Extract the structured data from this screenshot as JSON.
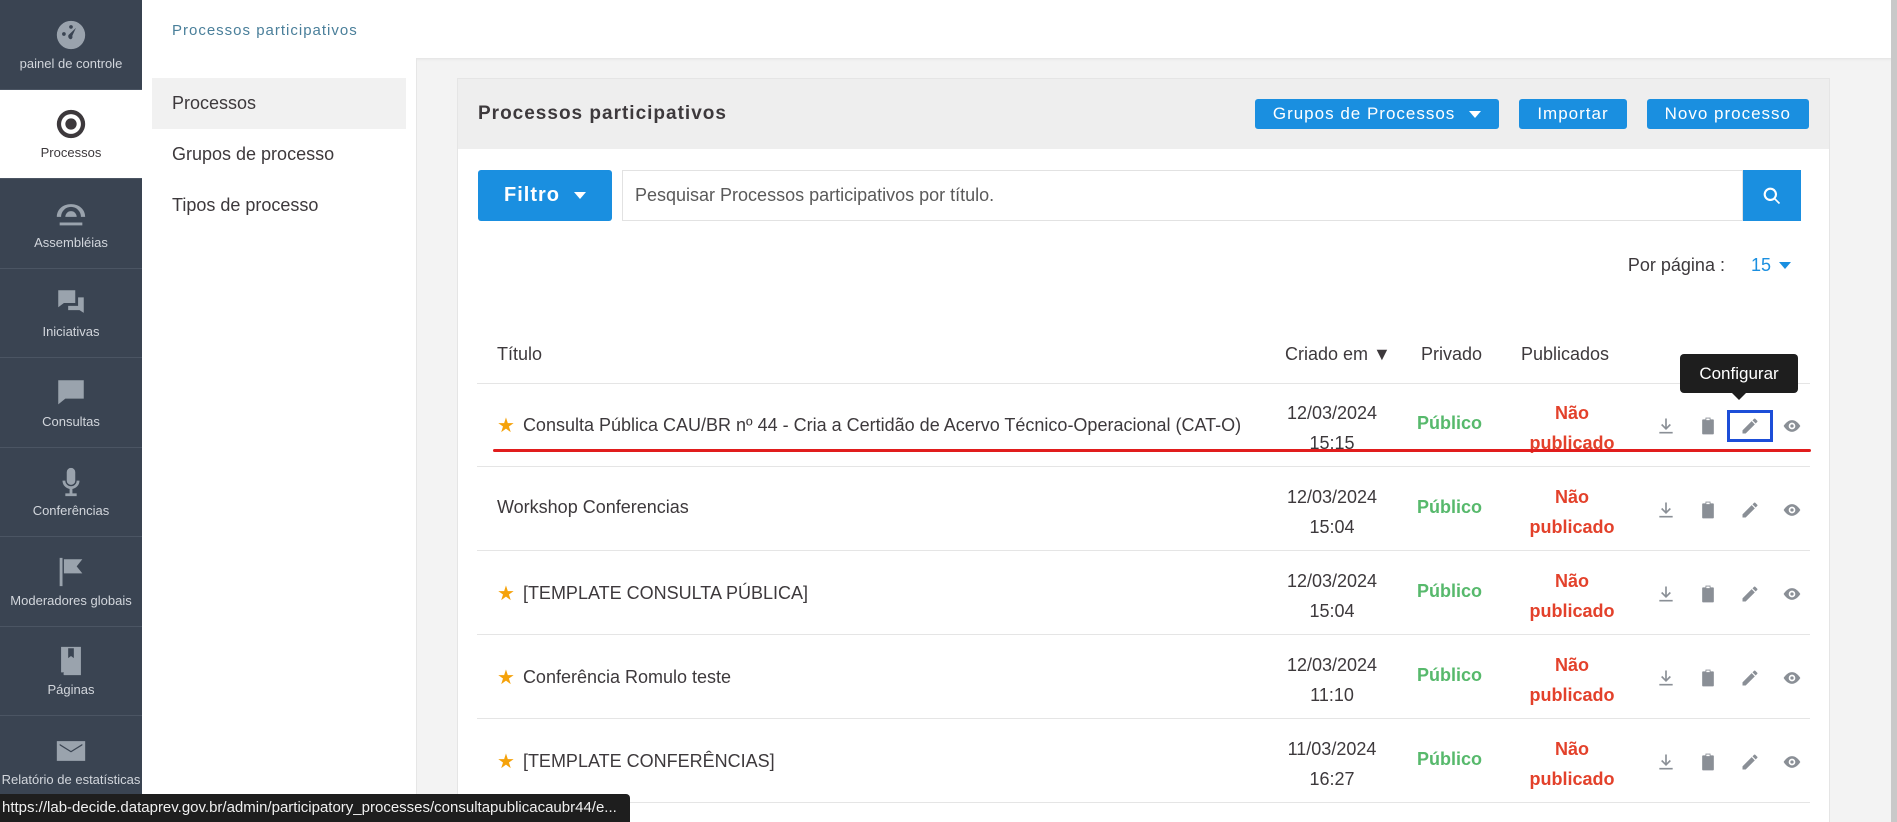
{
  "sidebar": {
    "items": [
      {
        "label": "painel de controle",
        "icon": "dashboard-icon"
      },
      {
        "label": "Processos",
        "icon": "target-icon"
      },
      {
        "label": "Assembléias",
        "icon": "assembly-icon"
      },
      {
        "label": "Iniciativas",
        "icon": "chat-bubbles-icon"
      },
      {
        "label": "Consultas",
        "icon": "chat-bubble-icon"
      },
      {
        "label": "Conferências",
        "icon": "microphone-icon"
      },
      {
        "label": "Moderadores globais",
        "icon": "flag-icon"
      },
      {
        "label": "Páginas",
        "icon": "book-icon"
      },
      {
        "label": "Relatório de estatísticas",
        "icon": "mail-icon"
      }
    ]
  },
  "topbar": {
    "breadcrumb": "Processos participativos"
  },
  "submenu": {
    "items": [
      {
        "label": "Processos"
      },
      {
        "label": "Grupos de processo"
      },
      {
        "label": "Tipos de processo"
      }
    ]
  },
  "card": {
    "title": "Processos participativos",
    "groups_button": "Grupos de Processos",
    "import_button": "Importar",
    "new_button": "Novo processo",
    "filter_button": "Filtro",
    "search_placeholder": "Pesquisar Processos participativos por título.",
    "per_page_label": "Por página :",
    "per_page_value": "15"
  },
  "table": {
    "headers": {
      "title": "Título",
      "created": "Criado em ▼",
      "private": "Privado",
      "published": "Publicados"
    },
    "rows": [
      {
        "title": "Consulta Pública CAU/BR nº 44 - Cria a Certidão de Acervo Técnico-Operacional (CAT-O)",
        "starred": true,
        "date": "12/03/2024",
        "time": "15:15",
        "private": "Público",
        "pub1": "Não",
        "pub2": "publicado"
      },
      {
        "title": "Workshop Conferencias",
        "starred": false,
        "date": "12/03/2024",
        "time": "15:04",
        "private": "Público",
        "pub1": "Não",
        "pub2": "publicado"
      },
      {
        "title": "[TEMPLATE CONSULTA PÚBLICA]",
        "starred": true,
        "date": "12/03/2024",
        "time": "15:04",
        "private": "Público",
        "pub1": "Não",
        "pub2": "publicado"
      },
      {
        "title": "Conferência Romulo teste",
        "starred": true,
        "date": "12/03/2024",
        "time": "11:10",
        "private": "Público",
        "pub1": "Não",
        "pub2": "publicado"
      },
      {
        "title": "[TEMPLATE CONFERÊNCIAS]",
        "starred": true,
        "date": "11/03/2024",
        "time": "16:27",
        "private": "Público",
        "pub1": "Não",
        "pub2": "publicado"
      }
    ]
  },
  "tooltip": "Configurar",
  "status_url": "https://lab-decide.dataprev.gov.br/admin/participatory_processes/consultapublicacaubr44/e...",
  "colors": {
    "accent": "#1a8fe0",
    "sidebar": "#3a4452",
    "public": "#57b96c",
    "unpublished": "#e3412b",
    "star": "#f5a20a",
    "highlight": "#1d4ed8",
    "underline": "#e11d1d"
  }
}
